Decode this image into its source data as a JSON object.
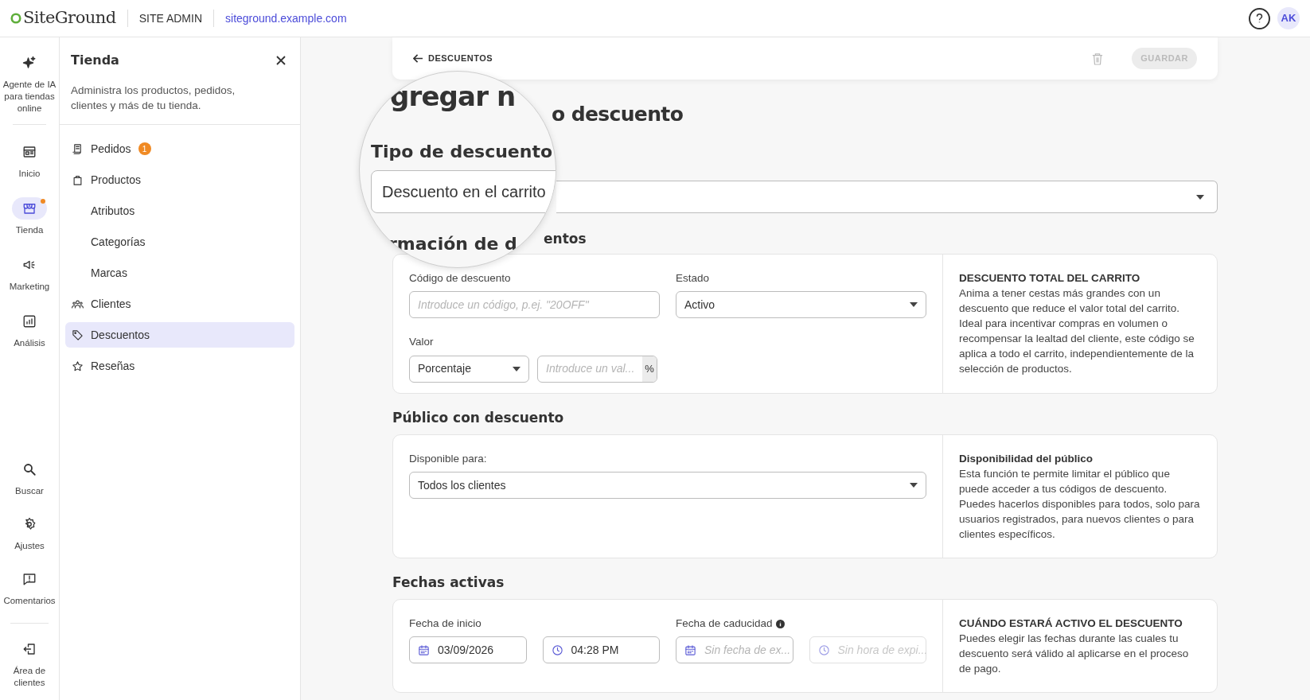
{
  "topbar": {
    "brand": "SiteGround",
    "section": "SITE ADMIN",
    "domain": "siteground.example.com",
    "avatar": "AK"
  },
  "rail": {
    "top": [
      {
        "label": "Agente de IA para tiendas online",
        "kind": "sparkle",
        "selected": false,
        "dot": false
      },
      {
        "label": "Inicio",
        "kind": "home",
        "selected": false,
        "dot": false
      },
      {
        "label": "Tienda",
        "kind": "store",
        "selected": true,
        "dot": true
      },
      {
        "label": "Marketing",
        "kind": "megaphone",
        "selected": false,
        "dot": false
      },
      {
        "label": "Análisis",
        "kind": "chart",
        "selected": false,
        "dot": false
      }
    ],
    "bottom": [
      {
        "label": "Buscar",
        "kind": "search",
        "selected": false,
        "dot": false
      },
      {
        "label": "Ajustes",
        "kind": "gear",
        "selected": false,
        "dot": false
      },
      {
        "label": "Comentarios",
        "kind": "feedback",
        "selected": false,
        "dot": false
      },
      {
        "label": "Área de clientes",
        "kind": "exit",
        "selected": false,
        "dot": false
      }
    ]
  },
  "sidebar": {
    "title": "Tienda",
    "description": "Administra los productos, pedidos, clientes y más de tu tienda.",
    "items": [
      {
        "label": "Pedidos",
        "kind": "receipt",
        "selected": false,
        "badge": "1"
      },
      {
        "label": "Productos",
        "kind": "bag",
        "selected": false,
        "children": [
          {
            "label": "Atributos",
            "selected": false
          },
          {
            "label": "Categorías",
            "selected": false
          },
          {
            "label": "Marcas",
            "selected": false
          }
        ]
      },
      {
        "label": "Clientes",
        "kind": "people",
        "selected": false
      },
      {
        "label": "Descuentos",
        "kind": "tag",
        "selected": true
      },
      {
        "label": "Reseñas",
        "kind": "star",
        "selected": false
      }
    ]
  },
  "page": {
    "back_link": "DESCUENTOS",
    "save_button": {
      "label": "GUARDAR",
      "disabled": true
    },
    "heading_fragment": "o descuento",
    "section_fragment": "entos",
    "info_section": {
      "fields": [
        {
          "label": "Código de descuento",
          "kind": "input",
          "placeholder": "Introduce un código, p.ej. \"20OFF\""
        },
        {
          "label": "Estado",
          "kind": "select",
          "value": "Activo"
        }
      ],
      "value_label": "Valor",
      "value_select": "Porcentaje",
      "value_input": {
        "placeholder": "Introduce un val...",
        "suffix": "%"
      },
      "aside_title": "DESCUENTO TOTAL DEL CARRITO",
      "aside_text": "Anima a tener cestas más grandes con un descuento que reduce el valor total del carrito. Ideal para incentivar compras en volumen o recompensar la lealtad del cliente, este código se aplica a todo el carrito, independientemente de la selección de productos."
    },
    "audience_section": {
      "title": "Público con descuento",
      "label": "Disponible para:",
      "value": "Todos los clientes",
      "aside_title": "Disponibilidad del público",
      "aside_text": "Esta función te permite limitar el público que puede acceder a tus códigos de descuento. Puedes hacerlos disponibles para todos, solo para usuarios registrados, para nuevos clientes o para clientes específicos."
    },
    "dates_section": {
      "title": "Fechas activas",
      "start_label": "Fecha de inicio",
      "end_label": "Fecha de caducidad",
      "fields": [
        {
          "kind": "date",
          "value": "03/09/2026",
          "disabled": false
        },
        {
          "kind": "time",
          "value": "04:28 PM",
          "disabled": false
        },
        {
          "kind": "date",
          "placeholder": "Sin fecha de ex...",
          "disabled": false
        },
        {
          "kind": "time",
          "placeholder": "Sin hora de expi...",
          "disabled": true
        }
      ],
      "aside_title": "CUÁNDO ESTARÁ ACTIVO EL DESCUENTO",
      "aside_text": "Puedes elegir las fechas durante las cuales tu descuento será válido al aplicarse en el proceso de pago."
    }
  },
  "magnifier": {
    "heading_fragment": "gregar n",
    "section_title": "Tipo de descuento",
    "select_value": "Descuento en el carrito",
    "section_fragment": "rmación de d"
  }
}
